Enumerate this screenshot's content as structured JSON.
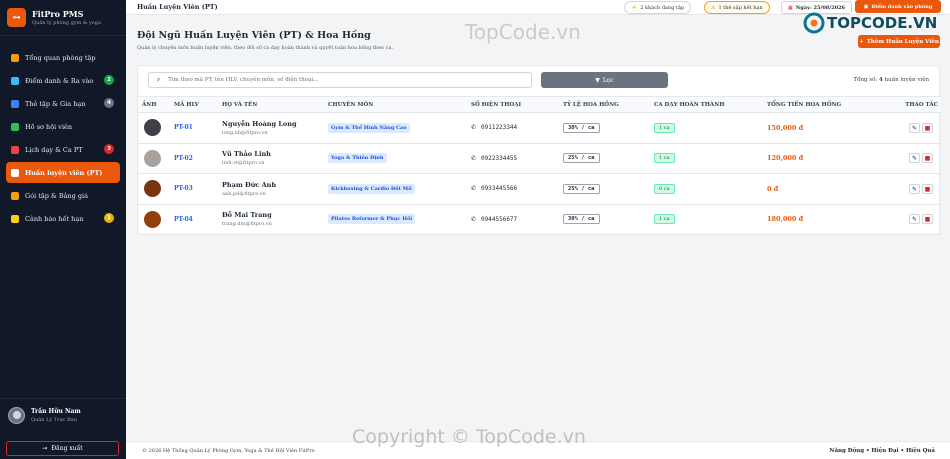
{
  "brand": {
    "name": "FitPro PMS",
    "subtitle": "Quản lý phòng gym & yoga"
  },
  "sidebar": {
    "items": [
      {
        "label": "Tổng quan phòng tập",
        "icon": "gauge-icon",
        "color": "#f59e0b",
        "badge": null
      },
      {
        "label": "Điểm danh & Ra vào",
        "icon": "id-card-icon",
        "color": "#38bdf8",
        "badge": "2",
        "badge_color": "#16a34a"
      },
      {
        "label": "Thẻ tập & Gia hạn",
        "icon": "card-icon",
        "color": "#3b82f6",
        "badge": "4",
        "badge_color": "#6b7280"
      },
      {
        "label": "Hồ sơ hội viên",
        "icon": "users-icon",
        "color": "#22c55e",
        "badge": null
      },
      {
        "label": "Lịch dạy & Ca PT",
        "icon": "calendar-icon",
        "color": "#ef4444",
        "badge": "3",
        "badge_color": "#dc2626"
      },
      {
        "label": "Huấn luyện viên (PT)",
        "icon": "trainer-icon",
        "color": "#ffffff",
        "badge": null,
        "active": true
      },
      {
        "label": "Gói tập & Bảng giá",
        "icon": "tag-icon",
        "color": "#f59e0b",
        "badge": null
      },
      {
        "label": "Cảnh báo hết hạn",
        "icon": "bell-icon",
        "color": "#facc15",
        "badge": "1",
        "badge_color": "#eab308"
      }
    ]
  },
  "user": {
    "name": "Trần Hữu Nam",
    "role": "Quản Lý Trực Ban"
  },
  "logout_label": "Đăng xuất",
  "topbar": {
    "title": "Huấn Luyện Viên (PT)",
    "pill1": "2 khách đang tập",
    "pill2": "1 thẻ sắp hết hạn",
    "date": "Ngày: 25/08/2026",
    "checkin_btn": "Điểm danh vào phòng"
  },
  "page": {
    "title": "Đội Ngũ Huấn Luyện Viên (PT) & Hoa Hồng",
    "subtitle": "Quản lý chuyên môn huấn luyện viên, theo dõi số ca dạy hoàn thành và quyết toán hoa hồng theo ca.",
    "add_btn": "Thêm Huấn Luyện Viên"
  },
  "search": {
    "placeholder": "Tìm theo mã PT, tên HLV, chuyên môn, số điện thoại..."
  },
  "filter_label": "Lọc",
  "total": {
    "prefix": "Tổng số:",
    "count": "4",
    "suffix": "huấn luyện viên"
  },
  "table": {
    "headers": [
      "ẢNH",
      "MÃ HLV",
      "HỌ VÀ TÊN",
      "CHUYÊN MÔN",
      "SỐ ĐIỆN THOẠI",
      "TỶ LỆ HOA HỒNG",
      "CA DẠY HOÀN THÀNH",
      "TỔNG TIỀN HOA HỒNG",
      "THAO TÁC"
    ],
    "rows": [
      {
        "code": "PT-01",
        "name": "Nguyễn Hoàng Long",
        "email": "long.nh@fitpro.vn",
        "spec": "Gym & Thể Hình Nâng Cao",
        "phone": "0911223344",
        "rate": "30% / ca",
        "done": "1 ca",
        "total": "150,000 đ",
        "avatar": "#3f3f46"
      },
      {
        "code": "PT-02",
        "name": "Vũ Thảo Linh",
        "email": "linh.vt@fitpro.vn",
        "spec": "Yoga & Thiền Định",
        "phone": "0922334455",
        "rate": "25% / ca",
        "done": "1 ca",
        "total": "120,000 đ",
        "avatar": "#a8a29e"
      },
      {
        "code": "PT-03",
        "name": "Phạm Đức Anh",
        "email": "anh.pd@fitpro.vn",
        "spec": "Kickboxing & Cardio Đốt Mỡ",
        "phone": "0933445566",
        "rate": "25% / ca",
        "done": "0 ca",
        "total": "0 đ",
        "avatar": "#78350f"
      },
      {
        "code": "PT-04",
        "name": "Đỗ Mai Trang",
        "email": "trang.dm@fitpro.vn",
        "spec": "Pilates Reformer & Phục Hồi",
        "phone": "0944556677",
        "rate": "30% / ca",
        "done": "1 ca",
        "total": "180,000 đ",
        "avatar": "#92400e"
      }
    ]
  },
  "footer": {
    "left": "© 2026 Hệ Thống Quản Lý Phòng Gym, Yoga & Thẻ Hội Viên FitPro",
    "right": "Năng Động • Hiện Đại • Hiệu Quả"
  },
  "watermark": {
    "logo": "TOPCODE.VN",
    "mid": "TopCode.vn",
    "bottom": "Copyright © TopCode.vn"
  }
}
